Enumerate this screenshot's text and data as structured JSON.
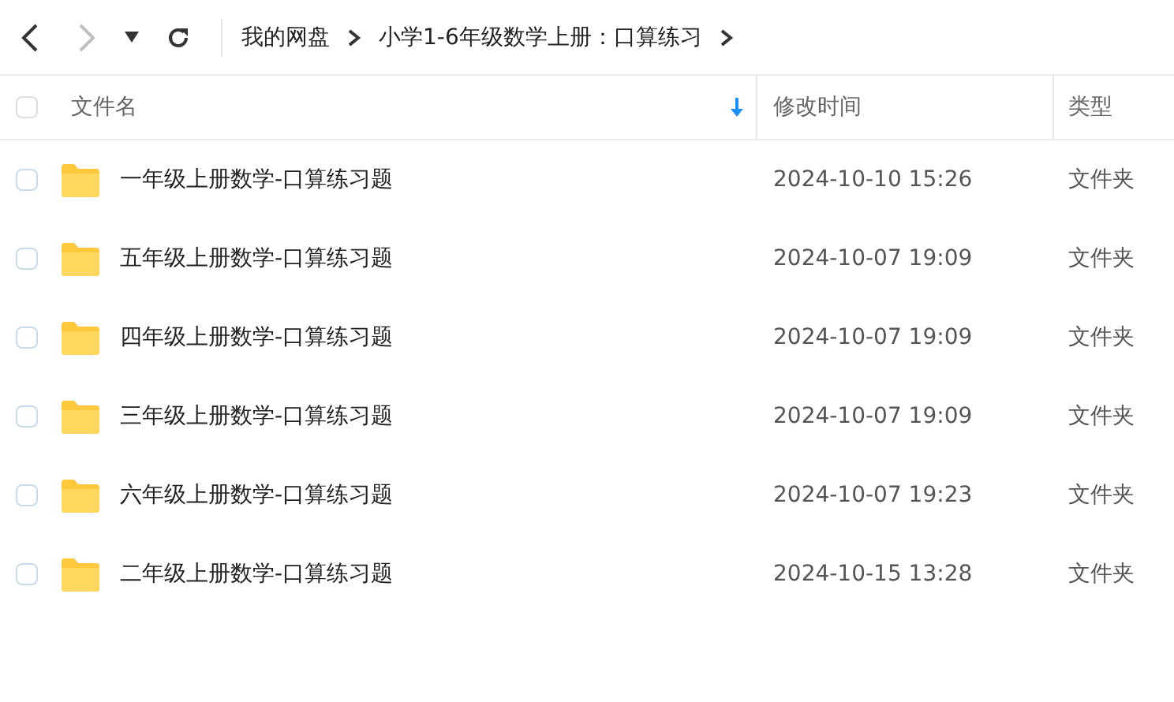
{
  "toolbar": {
    "back": {
      "disabled": false
    },
    "forward": {
      "disabled": true
    }
  },
  "breadcrumbs": [
    {
      "label": "我的网盘"
    },
    {
      "label": "小学1-6年级数学上册：口算练习"
    }
  ],
  "table": {
    "all_selected": false,
    "columns": [
      {
        "label": "文件名",
        "sorted": true
      },
      {
        "label": "修改时间",
        "sorted": false
      },
      {
        "label": "类型",
        "sorted": false
      }
    ],
    "rows": [
      {
        "name": "一年级上册数学-口算练习题",
        "modified": "2024-10-10 15:26",
        "type": "文件夹",
        "selected": false
      },
      {
        "name": "五年级上册数学-口算练习题",
        "modified": "2024-10-07 19:09",
        "type": "文件夹",
        "selected": false
      },
      {
        "name": "四年级上册数学-口算练习题",
        "modified": "2024-10-07 19:09",
        "type": "文件夹",
        "selected": false
      },
      {
        "name": "三年级上册数学-口算练习题",
        "modified": "2024-10-07 19:09",
        "type": "文件夹",
        "selected": false
      },
      {
        "name": "六年级上册数学-口算练习题",
        "modified": "2024-10-07 19:23",
        "type": "文件夹",
        "selected": false
      },
      {
        "name": "二年级上册数学-口算练习题",
        "modified": "2024-10-15 13:28",
        "type": "文件夹",
        "selected": false
      }
    ]
  }
}
